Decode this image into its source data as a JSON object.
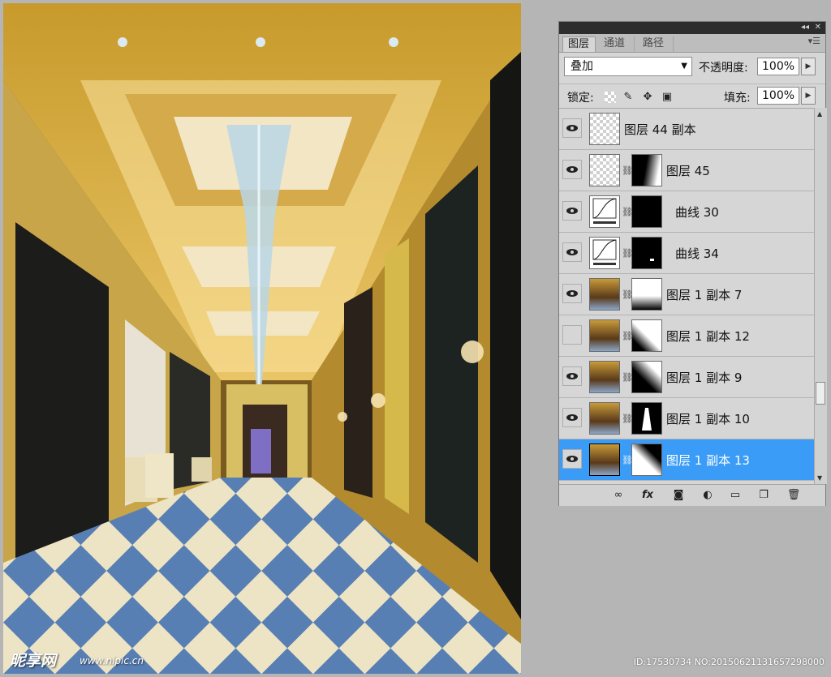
{
  "panel": {
    "tabs": [
      "图层",
      "通道",
      "路径"
    ],
    "blend_mode": "叠加",
    "opacity_label": "不透明度:",
    "opacity_value": "100%",
    "lock_label": "锁定:",
    "fill_label": "填充:",
    "fill_value": "100%",
    "layers": [
      {
        "name": "图层 44 副本",
        "visible": true,
        "type": "transparent",
        "mask": false,
        "selected": false
      },
      {
        "name": "图层 45",
        "visible": true,
        "type": "transparent",
        "mask": true,
        "selected": false
      },
      {
        "name": "曲线 30",
        "visible": true,
        "type": "curves",
        "mask": true,
        "selected": false
      },
      {
        "name": "曲线 34",
        "visible": true,
        "type": "curves",
        "mask": true,
        "selected": false
      },
      {
        "name": "图层 1 副本 7",
        "visible": true,
        "type": "photo",
        "mask": true,
        "selected": false
      },
      {
        "name": "图层 1 副本 12",
        "visible": false,
        "type": "photo",
        "mask": true,
        "selected": false
      },
      {
        "name": "图层 1 副本 9",
        "visible": true,
        "type": "photo",
        "mask": true,
        "selected": false
      },
      {
        "name": "图层 1 副本 10",
        "visible": true,
        "type": "photo",
        "mask": true,
        "selected": false
      },
      {
        "name": "图层 1 副本 13",
        "visible": true,
        "type": "photo",
        "mask": true,
        "selected": true
      }
    ],
    "bottom_icons": [
      "link-icon",
      "fx-icon",
      "mask-icon",
      "adjustment-icon",
      "folder-icon",
      "new-layer-icon",
      "trash-icon"
    ],
    "selection_color": "#3a9cf6"
  },
  "watermark": {
    "logo": "昵享网",
    "url": "www.nipic.cn",
    "id_text": "ID:17530734 NO:20150621131657298000"
  }
}
